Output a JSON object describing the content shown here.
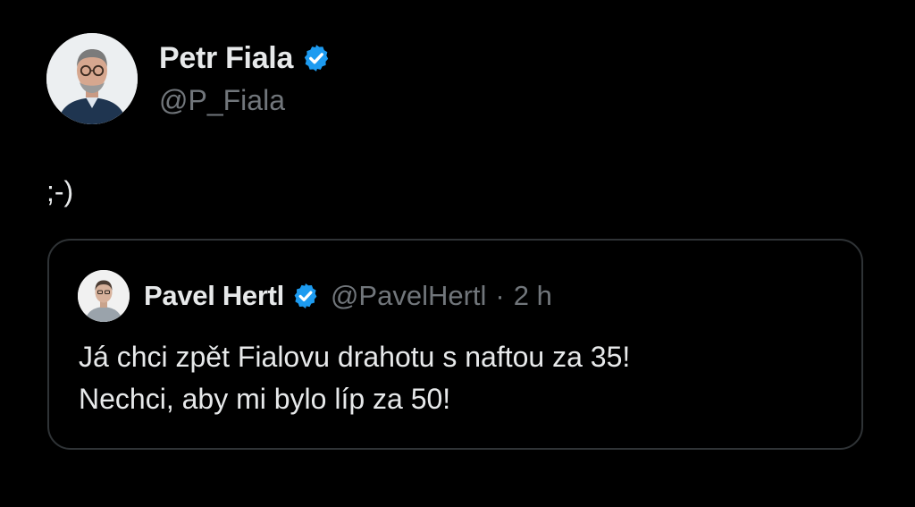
{
  "post": {
    "author": {
      "display_name": "Petr Fiala",
      "handle": "@P_Fiala",
      "verified": true,
      "avatar_icon": "profile-photo-avatar"
    },
    "text": ";-)"
  },
  "quoted_post": {
    "author": {
      "display_name": "Pavel Hertl",
      "handle": "@PavelHertl",
      "verified": true,
      "avatar_icon": "profile-photo-avatar"
    },
    "separator": "·",
    "time": "2 h",
    "lines": [
      "Já chci zpět Fialovu drahotu s naftou za 35!",
      "Nechci, aby mi bylo líp za 50!"
    ]
  },
  "colors": {
    "background": "#000000",
    "text_primary": "#e7e9ea",
    "text_secondary": "#71767b",
    "border": "#2f3336",
    "verified_badge": "#1d9bf0"
  }
}
